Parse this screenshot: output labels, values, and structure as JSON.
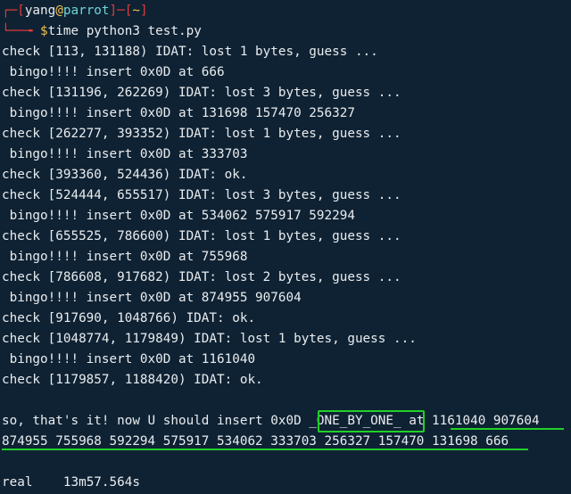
{
  "prompt": {
    "user": "yang",
    "at": "@",
    "host": "parrot",
    "dir": "~",
    "dollar": "$",
    "command": "time python3 test.py"
  },
  "output_lines": [
    "check [113, 131188) IDAT: lost 1 bytes, guess ...",
    " bingo!!!! insert 0x0D at 666",
    "check [131196, 262269) IDAT: lost 3 bytes, guess ...",
    " bingo!!!! insert 0x0D at 131698 157470 256327",
    "check [262277, 393352) IDAT: lost 1 bytes, guess ...",
    " bingo!!!! insert 0x0D at 333703",
    "check [393360, 524436) IDAT: ok.",
    "check [524444, 655517) IDAT: lost 3 bytes, guess ...",
    " bingo!!!! insert 0x0D at 534062 575917 592294",
    "check [655525, 786600) IDAT: lost 1 bytes, guess ...",
    " bingo!!!! insert 0x0D at 755968",
    "check [786608, 917682) IDAT: lost 2 bytes, guess ...",
    " bingo!!!! insert 0x0D at 874955 907604",
    "check [917690, 1048766) IDAT: ok.",
    "check [1048774, 1179849) IDAT: lost 1 bytes, guess ...",
    " bingo!!!! insert 0x0D at 1161040",
    "check [1179857, 1188420) IDAT: ok."
  ],
  "summary": {
    "prefix": "so, that's it! now U should insert 0x0D ",
    "highlight": "_ONE_BY_ONE_",
    "middle": " at ",
    "offsets_line1": "1161040 907604",
    "offsets_line2": "874955 755968 592294 575917 534062 333703 256327 157470 131698 666"
  },
  "timing": {
    "label": "real",
    "value": "13m57.564s"
  },
  "colors": {
    "background": "#0f2233",
    "highlight_green": "#22d02a",
    "prompt_red": "#e33b3b",
    "prompt_yellow": "#f2c14e",
    "prompt_cyan": "#6fd3d8"
  }
}
